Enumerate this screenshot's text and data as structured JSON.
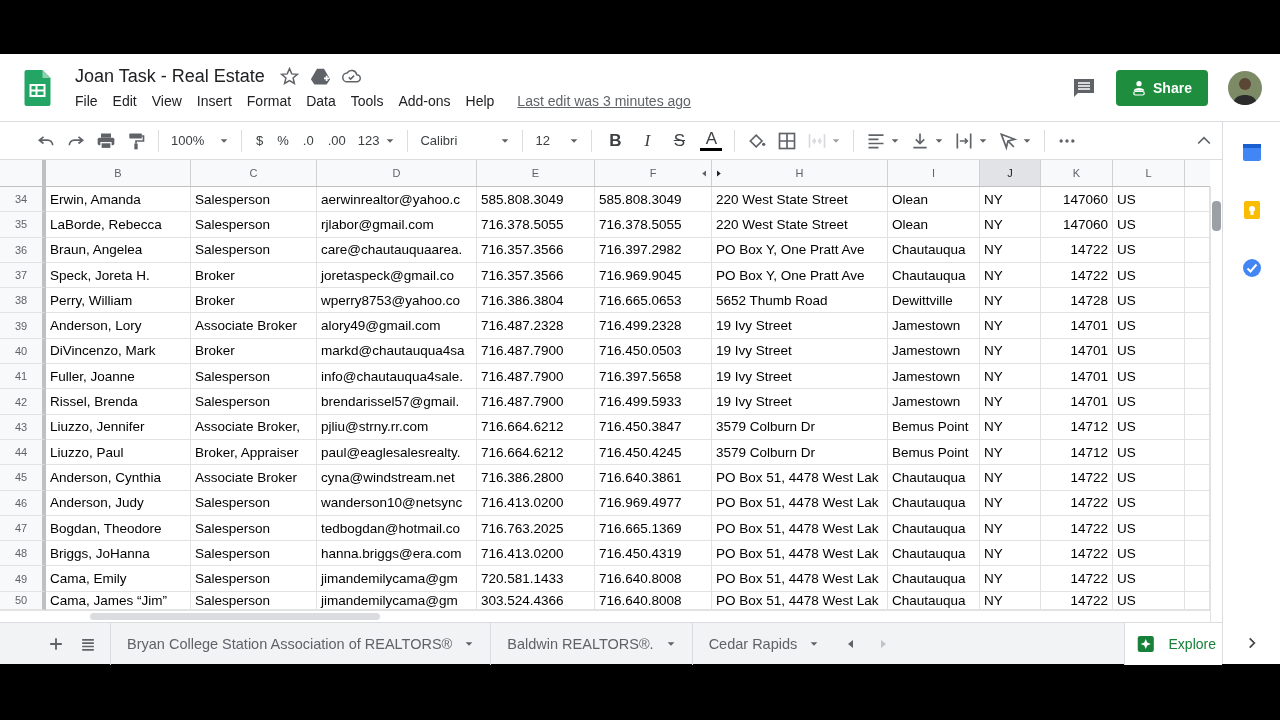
{
  "document": {
    "title": "Joan Task - Real Estate",
    "menus": [
      "File",
      "Edit",
      "View",
      "Insert",
      "Format",
      "Data",
      "Tools",
      "Add-ons",
      "Help"
    ],
    "last_edit": "Last edit was 3 minutes ago"
  },
  "share_button": "Share",
  "toolbar": {
    "zoom": "100%",
    "currency": "$",
    "percent": "%",
    "decrease_decimals": ".0",
    "increase_decimals": ".00",
    "number_format": "123",
    "font": "Calibri",
    "font_size": "12",
    "style_buttons": [
      {
        "kind": "bold",
        "label": "B"
      },
      {
        "kind": "italic",
        "label": "I"
      },
      {
        "kind": "strike",
        "label": "S"
      },
      {
        "kind": "text-color",
        "label": "A"
      }
    ],
    "merge": {
      "disabled": true
    }
  },
  "grid": {
    "columns": [
      {
        "label": "B",
        "selected": false,
        "kind": "text"
      },
      {
        "label": "C",
        "selected": false,
        "kind": "text"
      },
      {
        "label": "D",
        "selected": false,
        "kind": "text"
      },
      {
        "label": "E",
        "selected": false,
        "kind": "text"
      },
      {
        "label": "F",
        "selected": false,
        "kind": "text"
      },
      {
        "label": "H",
        "selected": false,
        "kind": "text"
      },
      {
        "label": "I",
        "selected": false,
        "kind": "text"
      },
      {
        "label": "J",
        "selected": true,
        "kind": "text"
      },
      {
        "label": "K",
        "selected": false,
        "kind": "number"
      },
      {
        "label": "L",
        "selected": false,
        "kind": "text"
      }
    ],
    "rows": [
      {
        "number": "34",
        "cells": [
          "Erwin, Amanda",
          "Salesperson",
          "aerwinrealtor@yahoo.c",
          "585.808.3049",
          "585.808.3049",
          "220 West State Street",
          "Olean",
          "NY",
          "147060",
          "US"
        ]
      },
      {
        "number": "35",
        "cells": [
          "LaBorde, Rebecca",
          "Salesperson",
          "rjlabor@gmail.com",
          "716.378.5055",
          "716.378.5055",
          "220 West State Street",
          "Olean",
          "NY",
          "147060",
          "US"
        ]
      },
      {
        "number": "36",
        "cells": [
          "Braun, Angelea",
          "Salesperson",
          "care@chautauquaarea.",
          "716.357.3566",
          "716.397.2982",
          "PO Box Y, One Pratt Ave",
          "Chautauqua",
          "NY",
          "14722",
          "US"
        ]
      },
      {
        "number": "37",
        "cells": [
          "Speck, Joreta H.",
          "Broker",
          "joretaspeck@gmail.co",
          "716.357.3566",
          "716.969.9045",
          "PO Box Y, One Pratt Ave",
          "Chautauqua",
          "NY",
          "14722",
          "US"
        ]
      },
      {
        "number": "38",
        "cells": [
          "Perry, William",
          "Broker",
          "wperry8753@yahoo.co",
          "716.386.3804",
          "716.665.0653",
          "5652 Thumb Road",
          "Dewittville",
          "NY",
          "14728",
          "US"
        ]
      },
      {
        "number": "39",
        "cells": [
          "Anderson, Lory",
          "Associate Broker",
          "alory49@gmail.com",
          "716.487.2328",
          "716.499.2328",
          "19 Ivy Street",
          "Jamestown",
          "NY",
          "14701",
          "US"
        ]
      },
      {
        "number": "40",
        "cells": [
          "DiVincenzo, Mark",
          "Broker",
          "markd@chautauqua4sa",
          "716.487.7900",
          "716.450.0503",
          "19 Ivy Street",
          "Jamestown",
          "NY",
          "14701",
          "US"
        ]
      },
      {
        "number": "41",
        "cells": [
          "Fuller, Joanne",
          "Salesperson",
          "info@chautauqua4sale.",
          "716.487.7900",
          "716.397.5658",
          "19 Ivy Street",
          "Jamestown",
          "NY",
          "14701",
          "US"
        ]
      },
      {
        "number": "42",
        "cells": [
          "Rissel, Brenda",
          "Salesperson",
          "brendarissel57@gmail.",
          "716.487.7900",
          "716.499.5933",
          "19 Ivy Street",
          "Jamestown",
          "NY",
          "14701",
          "US"
        ]
      },
      {
        "number": "43",
        "cells": [
          "Liuzzo, Jennifer",
          "Associate Broker,",
          "pjliu@strny.rr.com",
          "716.664.6212",
          "716.450.3847",
          "3579 Colburn Dr",
          "Bemus Point",
          "NY",
          "14712",
          "US"
        ]
      },
      {
        "number": "44",
        "cells": [
          "Liuzzo, Paul",
          "Broker, Appraiser",
          "paul@eaglesalesrealty.",
          "716.664.6212",
          "716.450.4245",
          "3579 Colburn Dr",
          "Bemus Point",
          "NY",
          "14712",
          "US"
        ]
      },
      {
        "number": "45",
        "cells": [
          "Anderson, Cynthia",
          "Associate Broker",
          "cyna@windstream.net",
          "716.386.2800",
          "716.640.3861",
          "PO Box 51, 4478 West Lak",
          "Chautauqua",
          "NY",
          "14722",
          "US"
        ]
      },
      {
        "number": "46",
        "cells": [
          "Anderson, Judy",
          "Salesperson",
          "wanderson10@netsync",
          "716.413.0200",
          "716.969.4977",
          "PO Box 51, 4478 West Lak",
          "Chautauqua",
          "NY",
          "14722",
          "US"
        ]
      },
      {
        "number": "47",
        "cells": [
          "Bogdan, Theodore",
          "Salesperson",
          "tedbogdan@hotmail.co",
          "716.763.2025",
          "716.665.1369",
          "PO Box 51, 4478 West Lak",
          "Chautauqua",
          "NY",
          "14722",
          "US"
        ]
      },
      {
        "number": "48",
        "cells": [
          "Briggs, JoHanna",
          "Salesperson",
          "hanna.briggs@era.com",
          "716.413.0200",
          "716.450.4319",
          "PO Box 51, 4478 West Lak",
          "Chautauqua",
          "NY",
          "14722",
          "US"
        ]
      },
      {
        "number": "49",
        "cells": [
          "Cama, Emily",
          "Salesperson",
          "jimandemilycama@gm",
          "720.581.1433",
          "716.640.8008",
          "PO Box 51, 4478 West Lak",
          "Chautauqua",
          "NY",
          "14722",
          "US"
        ]
      },
      {
        "number": "50",
        "cells": [
          "Cama, James “Jim”",
          "Salesperson",
          "jimandemilycama@gm",
          "303.524.4366",
          "716.640.8008",
          "PO Box 51, 4478 West Lak",
          "Chautauqua",
          "NY",
          "14722",
          "US"
        ]
      }
    ]
  },
  "sheets": [
    {
      "label": "Bryan College Station Association of REALTORS®",
      "selected": false
    },
    {
      "label": "Baldwin REALTORS®.",
      "selected": false
    },
    {
      "label": "Cedar Rapids",
      "selected": false
    }
  ],
  "explore_button": "Explore"
}
